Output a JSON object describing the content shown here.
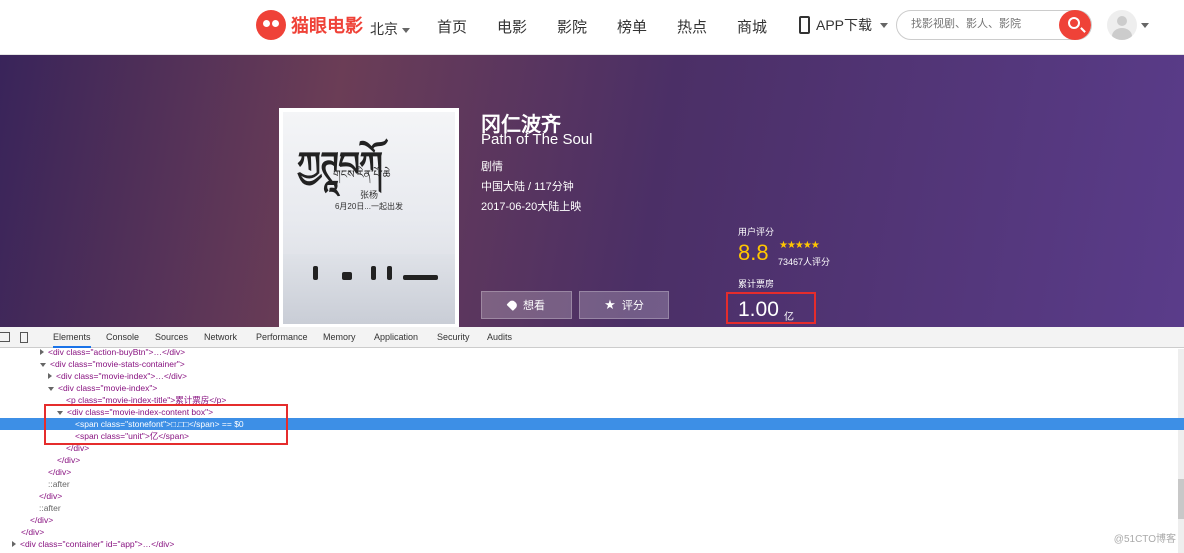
{
  "nav": {
    "logo": "猫眼电影",
    "city": "北京",
    "links": [
      "首页",
      "电影",
      "影院",
      "榜单",
      "热点",
      "商城"
    ],
    "app": "APP下载",
    "search_placeholder": "找影视剧、影人、影院"
  },
  "movie": {
    "title": "冈仁波齐",
    "en_title": "Path of The Soul",
    "genre": "剧情",
    "meta": "中国大陆 / 117分钟",
    "release": "2017-06-20大陆上映",
    "want_label": "想看",
    "rate_label": "评分",
    "score_label": "用户评分",
    "score": "8.8",
    "stars": "★★★★★",
    "votes": "73467人评分",
    "box_label": "累计票房",
    "box_value": "1.00",
    "box_unit": "亿"
  },
  "poster": {
    "title_art": "ཀྱཊཱབཀོ",
    "subtitle": "གངས་རིན་པོ་ཆེ",
    "director": "张杨",
    "release_note": "6月20日...一起出发"
  },
  "devtools": {
    "tabs": [
      "Elements",
      "Console",
      "Sources",
      "Network",
      "Performance",
      "Memory",
      "Application",
      "Security",
      "Audits"
    ],
    "watermark": "@51CTO博客",
    "lines": [
      "<div class=\"action-buyBtn\">…</div>",
      "<div class=\"movie-stats-container\">",
      "<div class=\"movie-index\">…</div>",
      "<div class=\"movie-index\">",
      "<p class=\"movie-index-title\">累计票房</p>",
      "<div class=\"movie-index-content box\">",
      "<span class=\"stonefont\">□.□□</span> == $0",
      "<span class=\"unit\">亿</span>",
      "</div>",
      "</div>",
      "</div>",
      "::after",
      "</div>",
      "::after",
      "</div>",
      "</div>",
      "<div class=\"container\" id=\"app\">…</div>"
    ]
  }
}
